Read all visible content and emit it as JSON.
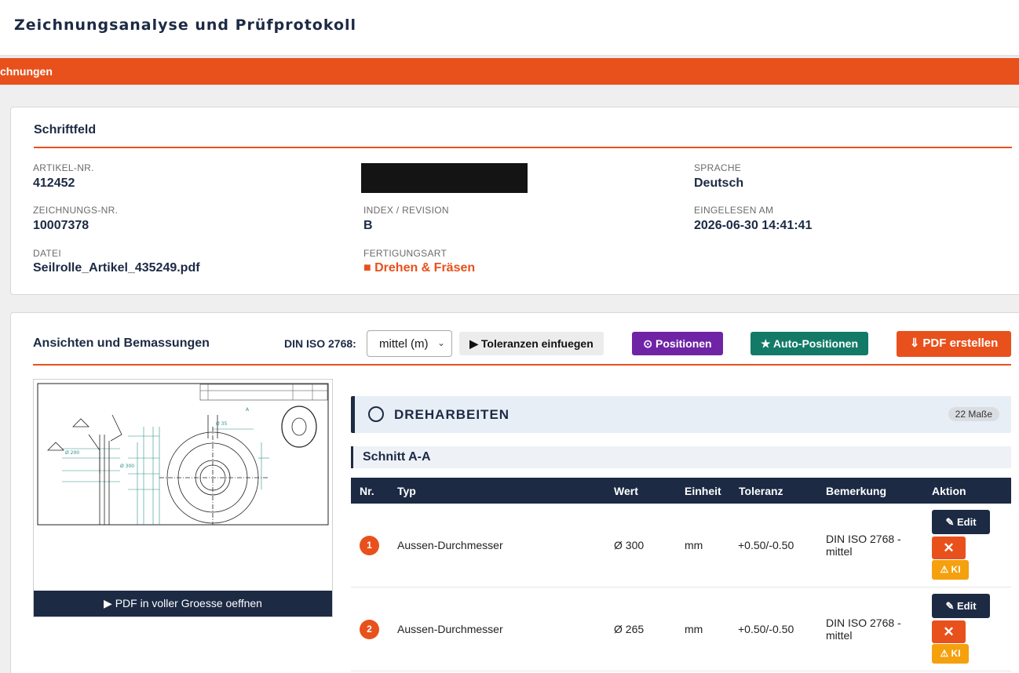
{
  "header": {
    "title": "Zeichnungsanalyse und Prüfprotokoll"
  },
  "nav": {
    "label": "chnungen"
  },
  "title_block": {
    "heading": "Schriftfeld",
    "fields": {
      "artikel_label": "ARTIKEL-NR.",
      "artikel_value": "412452",
      "sprache_label": "SPRACHE",
      "sprache_value": "Deutsch",
      "zeichnung_label": "ZEICHNUNGS-NR.",
      "zeichnung_value": "10007378",
      "index_label": "INDEX / REVISION",
      "index_value": "B",
      "eingelesen_label": "EINGELESEN AM",
      "eingelesen_value": "2026-06-30 14:41:41",
      "datei_label": "DATEI",
      "datei_value": "Seilrolle_Artikel_435249.pdf",
      "fertigung_label": "FERTIGUNGSART",
      "fertigung_value": "■ Drehen & Fräsen"
    }
  },
  "views": {
    "heading": "Ansichten und Bemassungen",
    "din_label": "DIN ISO 2768:",
    "tolerance_select": "mittel (m)",
    "btn_insert": "▶ Toleranzen einfuegen",
    "btn_positions": "⊙ Positionen",
    "btn_auto": "★ Auto-Positionen",
    "btn_pdf": "⇓ PDF erstellen",
    "open_pdf": "▶ PDF in voller Groesse oeffnen"
  },
  "group": {
    "title": "DREHARBEITEN",
    "count": "22 Maße",
    "section": "Schnitt A-A"
  },
  "table": {
    "headers": [
      "Nr.",
      "Typ",
      "Wert",
      "Einheit",
      "Toleranz",
      "Bemerkung",
      "Aktion"
    ],
    "rows": [
      {
        "nr": "1",
        "typ": "Aussen-Durchmesser",
        "wert": "Ø 300",
        "einheit": "mm",
        "toleranz": "+0.50/-0.50",
        "bemerkung": "DIN ISO 2768 - mittel"
      },
      {
        "nr": "2",
        "typ": "Aussen-Durchmesser",
        "wert": "Ø 265",
        "einheit": "mm",
        "toleranz": "+0.50/-0.50",
        "bemerkung": "DIN ISO 2768 - mittel"
      }
    ],
    "edit_label": "✎ Edit",
    "delete_label": "✕",
    "ki_label": "⚠ KI"
  },
  "colors": {
    "accent": "#e8511c",
    "navy": "#1c2a44",
    "purple": "#6f24a5",
    "green": "#137a67",
    "amber": "#f5a00d"
  }
}
